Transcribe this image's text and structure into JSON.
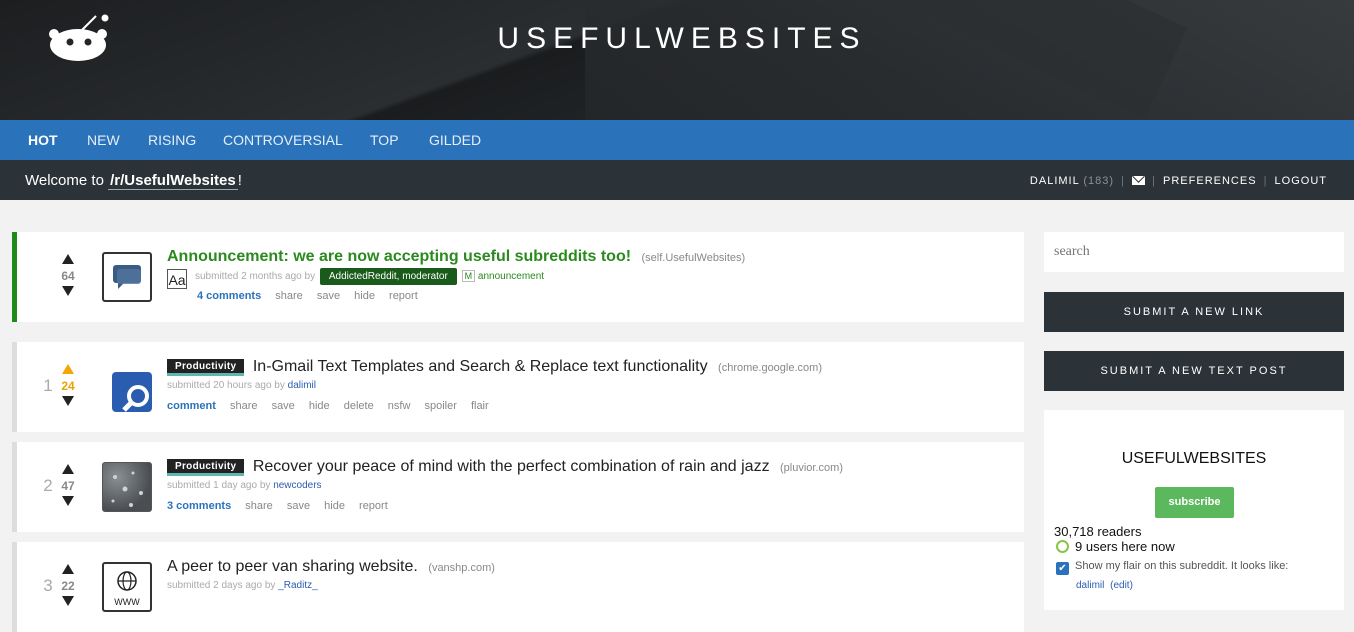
{
  "header": {
    "title": "USEFULWEBSITES",
    "logo": "reddit-alien-icon"
  },
  "tabs": [
    {
      "label": "HOT",
      "active": true
    },
    {
      "label": "NEW"
    },
    {
      "label": "RISING"
    },
    {
      "label": "CONTROVERSIAL"
    },
    {
      "label": "TOP"
    },
    {
      "label": "GILDED"
    }
  ],
  "welcome": {
    "prefix": "Welcome to",
    "subreddit": "/r/UsefulWebsites",
    "suffix": "!"
  },
  "user": {
    "name": "DALIMIL",
    "karma": "(183)",
    "mail_icon": "mail-icon",
    "preferences": "PREFERENCES",
    "logout": "LOGOUT"
  },
  "posts": [
    {
      "rank": "",
      "score": "64",
      "upvoted": false,
      "thumb_icon": "self-post-icon",
      "title": "Announcement: we are now accepting useful subreddits too!",
      "domain": "(self.UsefulWebsites)",
      "submitted": "submitted 2 months ago by",
      "author": "AddictedReddit, moderator",
      "mod_badge": "M",
      "link_flair": "announcement",
      "aa": "Aa",
      "buttons": [
        "4 comments",
        "share",
        "save",
        "hide",
        "report"
      ]
    },
    {
      "rank": "1",
      "score": "24",
      "upvoted": true,
      "thumb_icon": "magnifier-icon",
      "flair": "Productivity",
      "title": "In-Gmail Text Templates and Search & Replace text functionality",
      "domain": "(chrome.google.com)",
      "submitted": "submitted 20 hours ago by",
      "author": "dalimil",
      "buttons": [
        "comment",
        "share",
        "save",
        "hide",
        "delete",
        "nsfw",
        "spoiler",
        "flair"
      ]
    },
    {
      "rank": "2",
      "score": "47",
      "upvoted": false,
      "thumb_icon": "rain-photo-icon",
      "flair": "Productivity",
      "title": "Recover your peace of mind with the perfect combination of rain and jazz",
      "domain": "(pluvior.com)",
      "submitted": "submitted 1 day ago by",
      "author": "newcoders",
      "buttons": [
        "3 comments",
        "share",
        "save",
        "hide",
        "report"
      ]
    },
    {
      "rank": "3",
      "score": "22",
      "upvoted": false,
      "thumb_icon": "globe-www-icon",
      "thumb_text": "WWW",
      "title": "A peer to peer van sharing website.",
      "domain": "(vanshp.com)",
      "submitted": "submitted 2 days ago by",
      "author": "_Raditz_"
    }
  ],
  "sidebar": {
    "search_placeholder": "search",
    "submit_link": "SUBMIT A NEW LINK",
    "submit_text": "SUBMIT A NEW TEXT POST",
    "title": "USEFULWEBSITES",
    "subscribe": "subscribe",
    "readers": "30,718 readers",
    "here_now": "9 users here now",
    "flair_text": "Show my flair on this subreddit. It looks like:",
    "flair_user": "dalimil",
    "flair_edit": "(edit)"
  },
  "colors": {
    "tabbar": "#2a73bb",
    "darkbar": "#2b3338",
    "announcement": "#2a8a1e",
    "upvote": "#f5a500",
    "subscribe": "#5cb85c"
  }
}
